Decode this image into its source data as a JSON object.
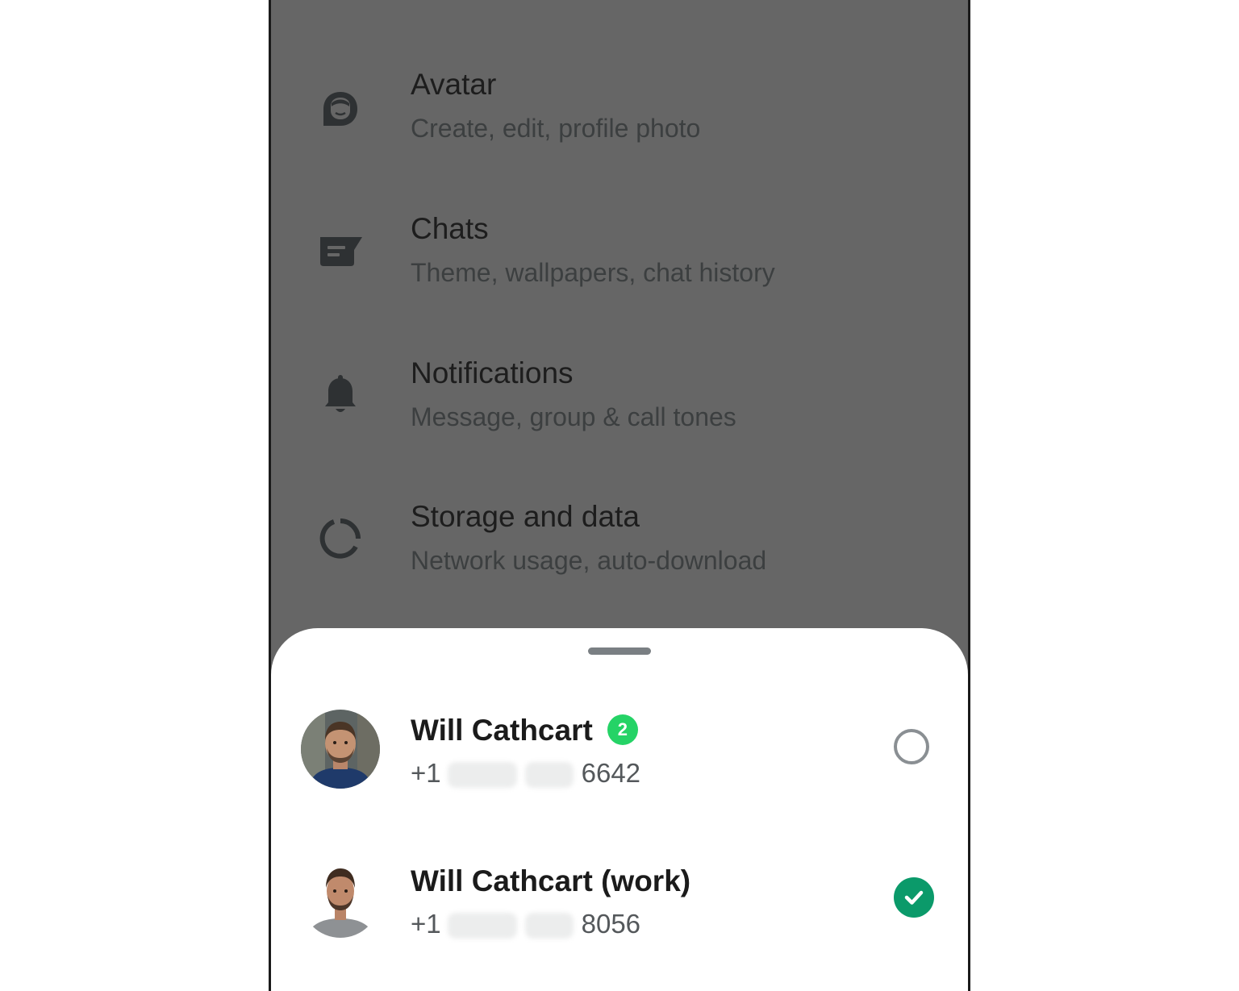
{
  "settings": {
    "items": [
      {
        "icon": "avatar-icon",
        "title": "Avatar",
        "subtitle": "Create, edit, profile photo"
      },
      {
        "icon": "chat-icon",
        "title": "Chats",
        "subtitle": "Theme, wallpapers, chat history"
      },
      {
        "icon": "bell-icon",
        "title": "Notifications",
        "subtitle": "Message, group & call tones"
      },
      {
        "icon": "storage-icon",
        "title": "Storage and data",
        "subtitle": "Network usage, auto-download"
      }
    ]
  },
  "account_sheet": {
    "accounts": [
      {
        "name": "Will Cathcart",
        "badge": "2",
        "phone_prefix": "+1",
        "phone_suffix": "6642",
        "selected": false
      },
      {
        "name": "Will Cathcart (work)",
        "badge": "",
        "phone_prefix": "+1",
        "phone_suffix": "8056",
        "selected": true
      }
    ]
  },
  "colors": {
    "overlay": "#666666",
    "badge": "#25d366",
    "selected": "#0b9a6a"
  }
}
